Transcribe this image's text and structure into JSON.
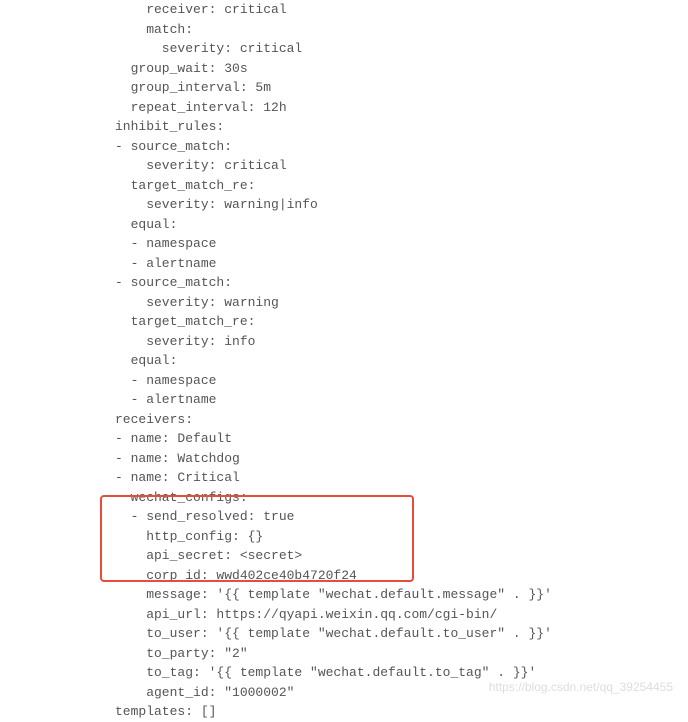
{
  "code": {
    "lines": [
      "    receiver: critical",
      "    match:",
      "      severity: critical",
      "  group_wait: 30s",
      "  group_interval: 5m",
      "  repeat_interval: 12h",
      "inhibit_rules:",
      "- source_match:",
      "    severity: critical",
      "  target_match_re:",
      "    severity: warning|info",
      "  equal:",
      "  - namespace",
      "  - alertname",
      "- source_match:",
      "    severity: warning",
      "  target_match_re:",
      "    severity: info",
      "  equal:",
      "  - namespace",
      "  - alertname",
      "receivers:",
      "- name: Default",
      "- name: Watchdog",
      "- name: Critical",
      "  wechat_configs:",
      "  - send_resolved: true",
      "    http_config: {}",
      "    api_secret: <secret>",
      "    corp_id: wwd402ce40b4720f24",
      "    message: '{{ template \"wechat.default.message\" . }}'",
      "    api_url: https://qyapi.weixin.qq.com/cgi-bin/",
      "    to_user: '{{ template \"wechat.default.to_user\" . }}'",
      "    to_party: \"2\"",
      "    to_tag: '{{ template \"wechat.default.to_tag\" . }}'",
      "    agent_id: \"1000002\"",
      "templates: []"
    ]
  },
  "watermark": "https://blog.csdn.net/qq_39254455"
}
